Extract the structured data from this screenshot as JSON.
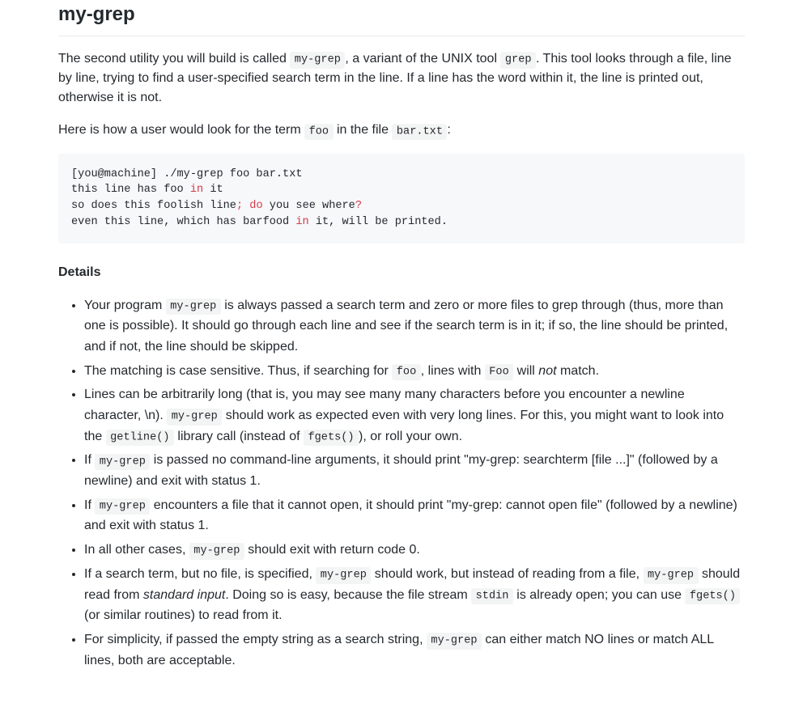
{
  "title": "my-grep",
  "intro": {
    "p1_a": "The second utility you will build is called ",
    "p1_code1": "my-grep",
    "p1_b": ", a variant of the UNIX tool ",
    "p1_code2": "grep",
    "p1_c": ". This tool looks through a file, line by line, trying to find a user-specified search term in the line. If a line has the word within it, the line is printed out, otherwise it is not.",
    "p2_a": "Here is how a user would look for the term ",
    "p2_code1": "foo",
    "p2_b": " in the file ",
    "p2_code2": "bar.txt",
    "p2_c": ":"
  },
  "codeblock": {
    "l1": "[you@machine] ./my-grep foo bar.txt",
    "l2a": "this line has foo ",
    "l2k": "in",
    "l2b": " it",
    "l3a": "so does this foolish line",
    "l3k1": ";",
    "l3b": " ",
    "l3k2": "do",
    "l3c": " you see where",
    "l3k3": "?",
    "l4a": "even this line, which has barfood ",
    "l4k": "in",
    "l4b": " it, will be printed."
  },
  "details_heading": "Details",
  "details": {
    "i1_a": "Your program ",
    "i1_code1": "my-grep",
    "i1_b": " is always passed a search term and zero or more files to grep through (thus, more than one is possible). It should go through each line and see if the search term is in it; if so, the line should be printed, and if not, the line should be skipped.",
    "i2_a": "The matching is case sensitive. Thus, if searching for ",
    "i2_code1": "foo",
    "i2_b": ", lines with ",
    "i2_code2": "Foo",
    "i2_c": " will ",
    "i2_em": "not",
    "i2_d": " match.",
    "i3_a": "Lines can be arbitrarily long (that is, you may see many many characters before you encounter a newline character, \\n). ",
    "i3_code1": "my-grep",
    "i3_b": " should work as expected even with very long lines. For this, you might want to look into the ",
    "i3_code2": "getline()",
    "i3_c": " library call (instead of ",
    "i3_code3": "fgets()",
    "i3_d": "), or roll your own.",
    "i4_a": "If ",
    "i4_code1": "my-grep",
    "i4_b": " is passed no command-line arguments, it should print \"my-grep: searchterm [file ...]\" (followed by a newline) and exit with status 1.",
    "i5_a": "If ",
    "i5_code1": "my-grep",
    "i5_b": " encounters a file that it cannot open, it should print \"my-grep: cannot open file\" (followed by a newline) and exit with status 1.",
    "i6_a": "In all other cases, ",
    "i6_code1": "my-grep",
    "i6_b": " should exit with return code 0.",
    "i7_a": "If a search term, but no file, is specified, ",
    "i7_code1": "my-grep",
    "i7_b": " should work, but instead of reading from a file, ",
    "i7_code2": "my-grep",
    "i7_c": " should read from ",
    "i7_em": "standard input",
    "i7_d": ". Doing so is easy, because the file stream ",
    "i7_code3": "stdin",
    "i7_e": " is already open; you can use ",
    "i7_code4": "fgets()",
    "i7_f": " (or similar routines) to read from it.",
    "i8_a": "For simplicity, if passed the empty string as a search string, ",
    "i8_code1": "my-grep",
    "i8_b": " can either match NO lines or match ALL lines, both are acceptable."
  }
}
